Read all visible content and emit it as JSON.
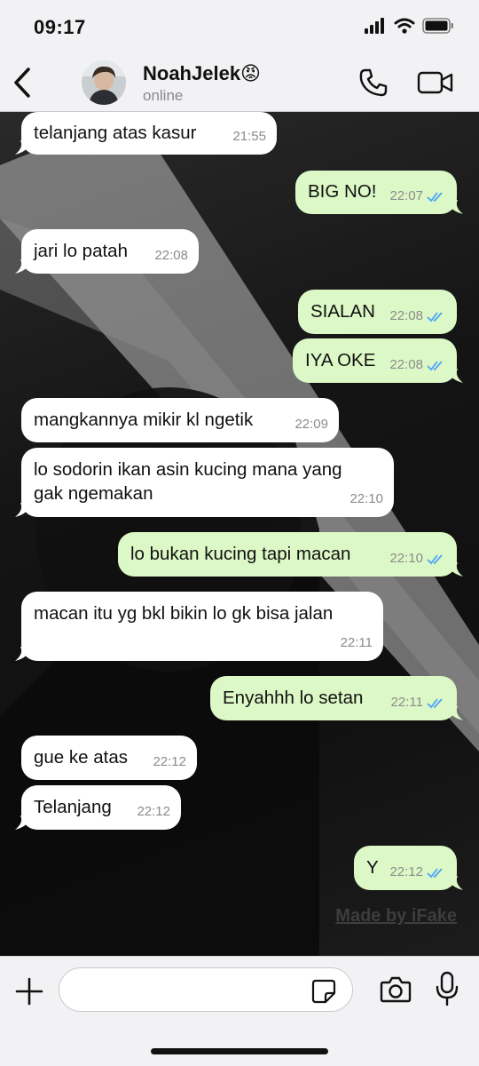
{
  "status_bar": {
    "time": "09:17"
  },
  "header": {
    "contact_name": "NoahJelek😡",
    "contact_status": "online"
  },
  "messages": [
    {
      "direction": "in",
      "text": "telanjang atas kasur",
      "time": "21:55"
    },
    {
      "direction": "out",
      "text": "BIG NO!",
      "time": "22:07",
      "read": true
    },
    {
      "direction": "in",
      "text": "jari lo patah",
      "time": "22:08"
    },
    {
      "direction": "out",
      "text": "SIALAN",
      "time": "22:08",
      "read": true
    },
    {
      "direction": "out",
      "text": "IYA OKE",
      "time": "22:08",
      "read": true
    },
    {
      "direction": "in",
      "text": "mangkannya mikir kl ngetik",
      "time": "22:09"
    },
    {
      "direction": "in",
      "lines": [
        "lo sodorin ikan asin kucing mana yang",
        "gak ngemakan"
      ],
      "time": "22:10"
    },
    {
      "direction": "out",
      "text": "lo bukan kucing tapi macan",
      "time": "22:10",
      "read": true
    },
    {
      "direction": "in",
      "text": "macan itu yg bkl bikin lo gk bisa jalan",
      "time": "22:11"
    },
    {
      "direction": "out",
      "text": "Enyahhh lo setan",
      "time": "22:11",
      "read": true
    },
    {
      "direction": "in",
      "text": "gue ke atas",
      "time": "22:12"
    },
    {
      "direction": "in",
      "text": "Telanjang",
      "time": "22:12"
    },
    {
      "direction": "out",
      "text": "Y",
      "time": "22:12",
      "read": true
    }
  ],
  "watermark": "Made by iFake",
  "composer": {
    "placeholder": ""
  },
  "colors": {
    "outgoing_bubble": "#dcf8c6",
    "incoming_bubble": "#ffffff",
    "read_ticks": "#4fa3f7",
    "header_bg": "#f2f2f4"
  }
}
